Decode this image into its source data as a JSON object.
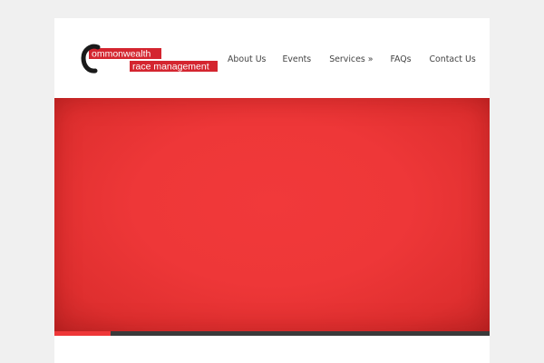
{
  "logo": {
    "line1": "ommonwealth",
    "line2": "race management",
    "brand_color": "#d4252f",
    "mark_color": "#1a1a1a"
  },
  "nav": {
    "items": [
      {
        "label": "About Us"
      },
      {
        "label": "Events"
      },
      {
        "label": "Services »"
      },
      {
        "label": "FAQs"
      },
      {
        "label": "Contact Us"
      }
    ]
  },
  "hero": {
    "color": "#ee3738"
  },
  "slider": {
    "progress": 0.13,
    "fill_color": "#ee3738",
    "track_color": "#3a3a3a"
  },
  "colors": {
    "background": "#f0f0f0",
    "page": "#ffffff",
    "nav_text": "#444444"
  }
}
